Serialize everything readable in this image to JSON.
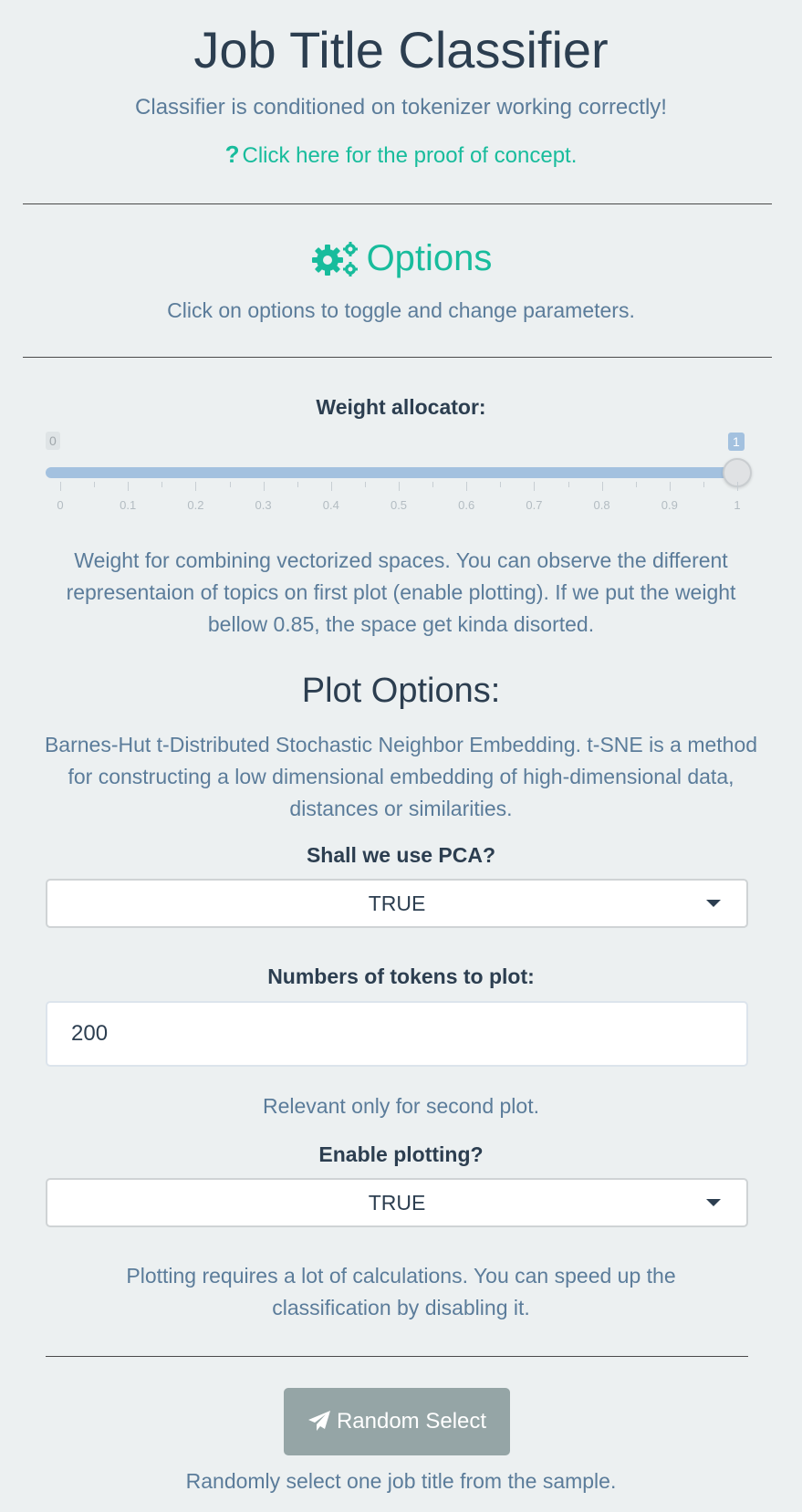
{
  "header": {
    "title": "Job Title Classifier",
    "subtitle": "Classifier is conditioned on tokenizer working correctly!",
    "proof_icon": "question-icon",
    "proof_link": "Click here for the proof of concept."
  },
  "options": {
    "icon": "gears-icon",
    "heading": "Options",
    "description": "Click on options to toggle and change parameters."
  },
  "weight_slider": {
    "label": "Weight allocator:",
    "min_label": "0",
    "value_label": "1",
    "value": 1,
    "min": 0,
    "max": 1,
    "tick_labels": [
      "0",
      "0.1",
      "0.2",
      "0.3",
      "0.4",
      "0.5",
      "0.6",
      "0.7",
      "0.8",
      "0.9",
      "1"
    ],
    "help": "Weight for combining vectorized spaces. You can observe the different representaion of topics on first plot (enable plotting). If we put the weight bellow 0.85, the space get kinda disorted."
  },
  "plot_options": {
    "heading": "Plot Options:",
    "description": "Barnes-Hut t-Distributed Stochastic Neighbor Embedding. t-SNE is a method for constructing a low dimensional embedding of high-dimensional data, distances or similarities.",
    "pca": {
      "label": "Shall we use PCA?",
      "value": "TRUE"
    },
    "tokens": {
      "label": "Numbers of tokens to plot:",
      "value": "200",
      "help": "Relevant only for second plot."
    },
    "plotting": {
      "label": "Enable plotting?",
      "value": "TRUE",
      "help": "Plotting requires a lot of calculations. You can speed up the classification by disabling it."
    }
  },
  "random": {
    "icon": "paper-plane-icon",
    "button_label": "Random Select",
    "help": "Randomly select one job title from the sample."
  },
  "colors": {
    "accent": "#18bc9c",
    "text": "#2c3e50",
    "muted_text": "#5b7c9a",
    "slider_fill": "#a3c1df",
    "button": "#95a5a6",
    "background": "#ecf0f1"
  }
}
